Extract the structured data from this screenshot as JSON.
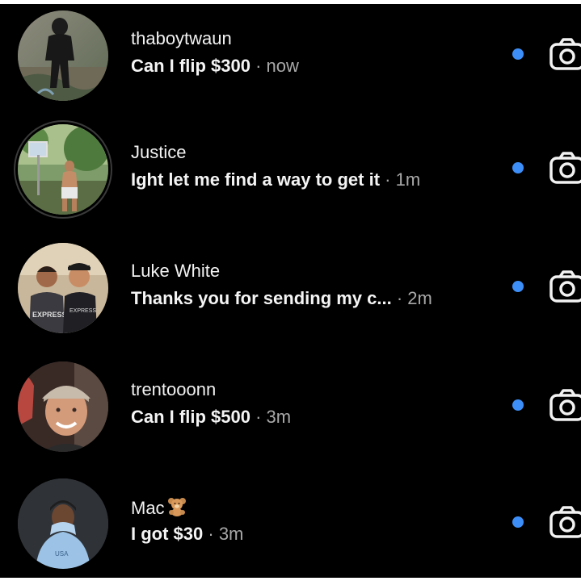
{
  "threads": [
    {
      "username": "thaboytwaun",
      "message": "Can I flip $300",
      "separator": " · ",
      "time": "now",
      "unread": true
    },
    {
      "username": "Justice",
      "message": "Ight let me find a way to get it",
      "separator": " · ",
      "time": "1m",
      "unread": true
    },
    {
      "username": "Luke White",
      "message": "Thanks you for sending my c...",
      "separator": " · ",
      "time": "2m",
      "unread": true
    },
    {
      "username": "trentooonn",
      "message": "Can I flip $500",
      "separator": " · ",
      "time": "3m",
      "unread": true
    },
    {
      "username": "Mac",
      "username_emoji": "teddy-bear-emoji",
      "message": "I got $30",
      "separator": " · ",
      "time": "3m",
      "unread": true
    }
  ],
  "icons": {
    "camera": "camera-icon",
    "unread": "unread-dot"
  },
  "colors": {
    "background": "#000000",
    "unread_dot": "#3d8ef7",
    "username": "#f2f2f2",
    "message": "#f4f4f4",
    "time": "#a8a8a8"
  }
}
